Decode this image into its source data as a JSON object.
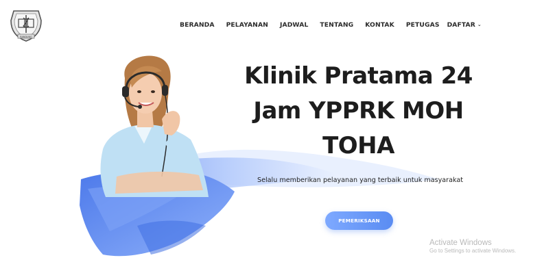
{
  "nav": {
    "items": [
      {
        "label": "BERANDA"
      },
      {
        "label": "PELAYANAN"
      },
      {
        "label": "JADWAL"
      },
      {
        "label": "TENTANG"
      },
      {
        "label": "KONTAK"
      },
      {
        "label": "PETUGAS"
      },
      {
        "label": "DAFTAR",
        "has_dropdown": true
      }
    ]
  },
  "hero": {
    "title_lines": [
      "Klinik Pratama 24",
      "Jam YPPRK MOH",
      "TOHA"
    ],
    "tagline": "Selalu memberikan pelayanan yang terbaik untuk masyarakat",
    "cta_label": "PEMERIKSAAN"
  },
  "logo": {
    "icon": "clinic-emblem-icon",
    "text": "BANDUNG"
  },
  "watermark": {
    "title": "Activate Windows",
    "subtitle": "Go to Settings to activate Windows."
  },
  "colors": {
    "accent": "#5a8cf2",
    "brush_light": "#c9d9fb",
    "brush_dark": "#4f7fec",
    "text": "#1d1d1d"
  }
}
